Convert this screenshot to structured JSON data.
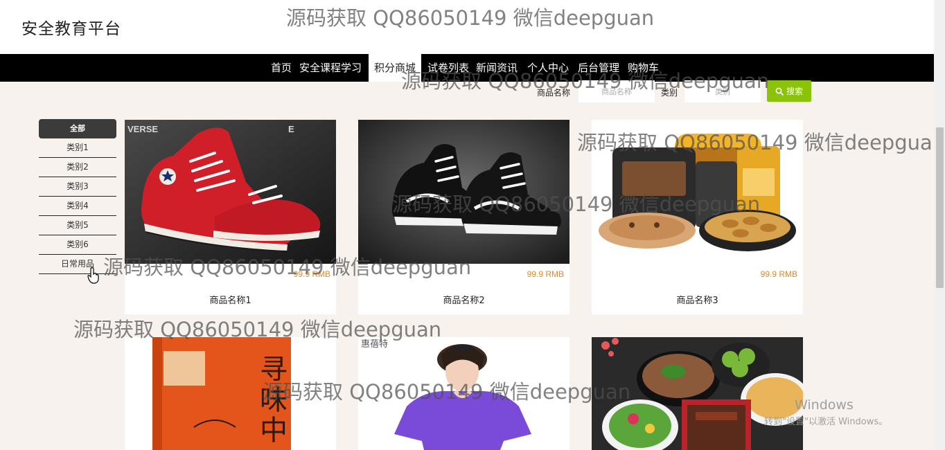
{
  "site": {
    "title": "安全教育平台"
  },
  "nav": {
    "items": [
      {
        "label": "首页"
      },
      {
        "label": "安全课程学习"
      },
      {
        "label": "积分商城",
        "active": true
      },
      {
        "label": "试卷列表"
      },
      {
        "label": "新闻资讯"
      },
      {
        "label": "个人中心"
      },
      {
        "label": "后台管理"
      },
      {
        "label": "购物车"
      }
    ]
  },
  "search": {
    "name_label": "商品名称",
    "name_placeholder": "商品名称",
    "category_label": "类别",
    "category_placeholder": "类别",
    "button_label": "搜索"
  },
  "categories": {
    "all_label": "全部",
    "items": [
      "类别1",
      "类别2",
      "类别3",
      "类别4",
      "类别5",
      "类别6",
      "日常用品"
    ]
  },
  "products": [
    {
      "name": "商品名称1",
      "price": "99.9 RMB",
      "image_icon": "red-sneaker-image"
    },
    {
      "name": "商品名称2",
      "price": "99.9 RMB",
      "image_icon": "black-sneaker-image"
    },
    {
      "name": "商品名称3",
      "price": "99.9 RMB",
      "image_icon": "snack-package-image"
    },
    {
      "image_icon": "book-cover-image"
    },
    {
      "image_icon": "purple-outfit-image"
    },
    {
      "image_icon": "food-bowls-image"
    }
  ],
  "watermark": {
    "text": "源码获取 QQ86050149 微信deepguan",
    "photo_brand": "VERSE",
    "photo_brand_2": "惠蓓特"
  },
  "os_overlay": {
    "line1": "Windows",
    "line2": "转到\"设置\"以激活 Windows。"
  },
  "colors": {
    "nav_bg": "#000000",
    "page_bg": "#f7f2ee",
    "search_button": "#8bc20a",
    "price": "#e08a2e",
    "category_all_bg": "#3b3b3b"
  }
}
